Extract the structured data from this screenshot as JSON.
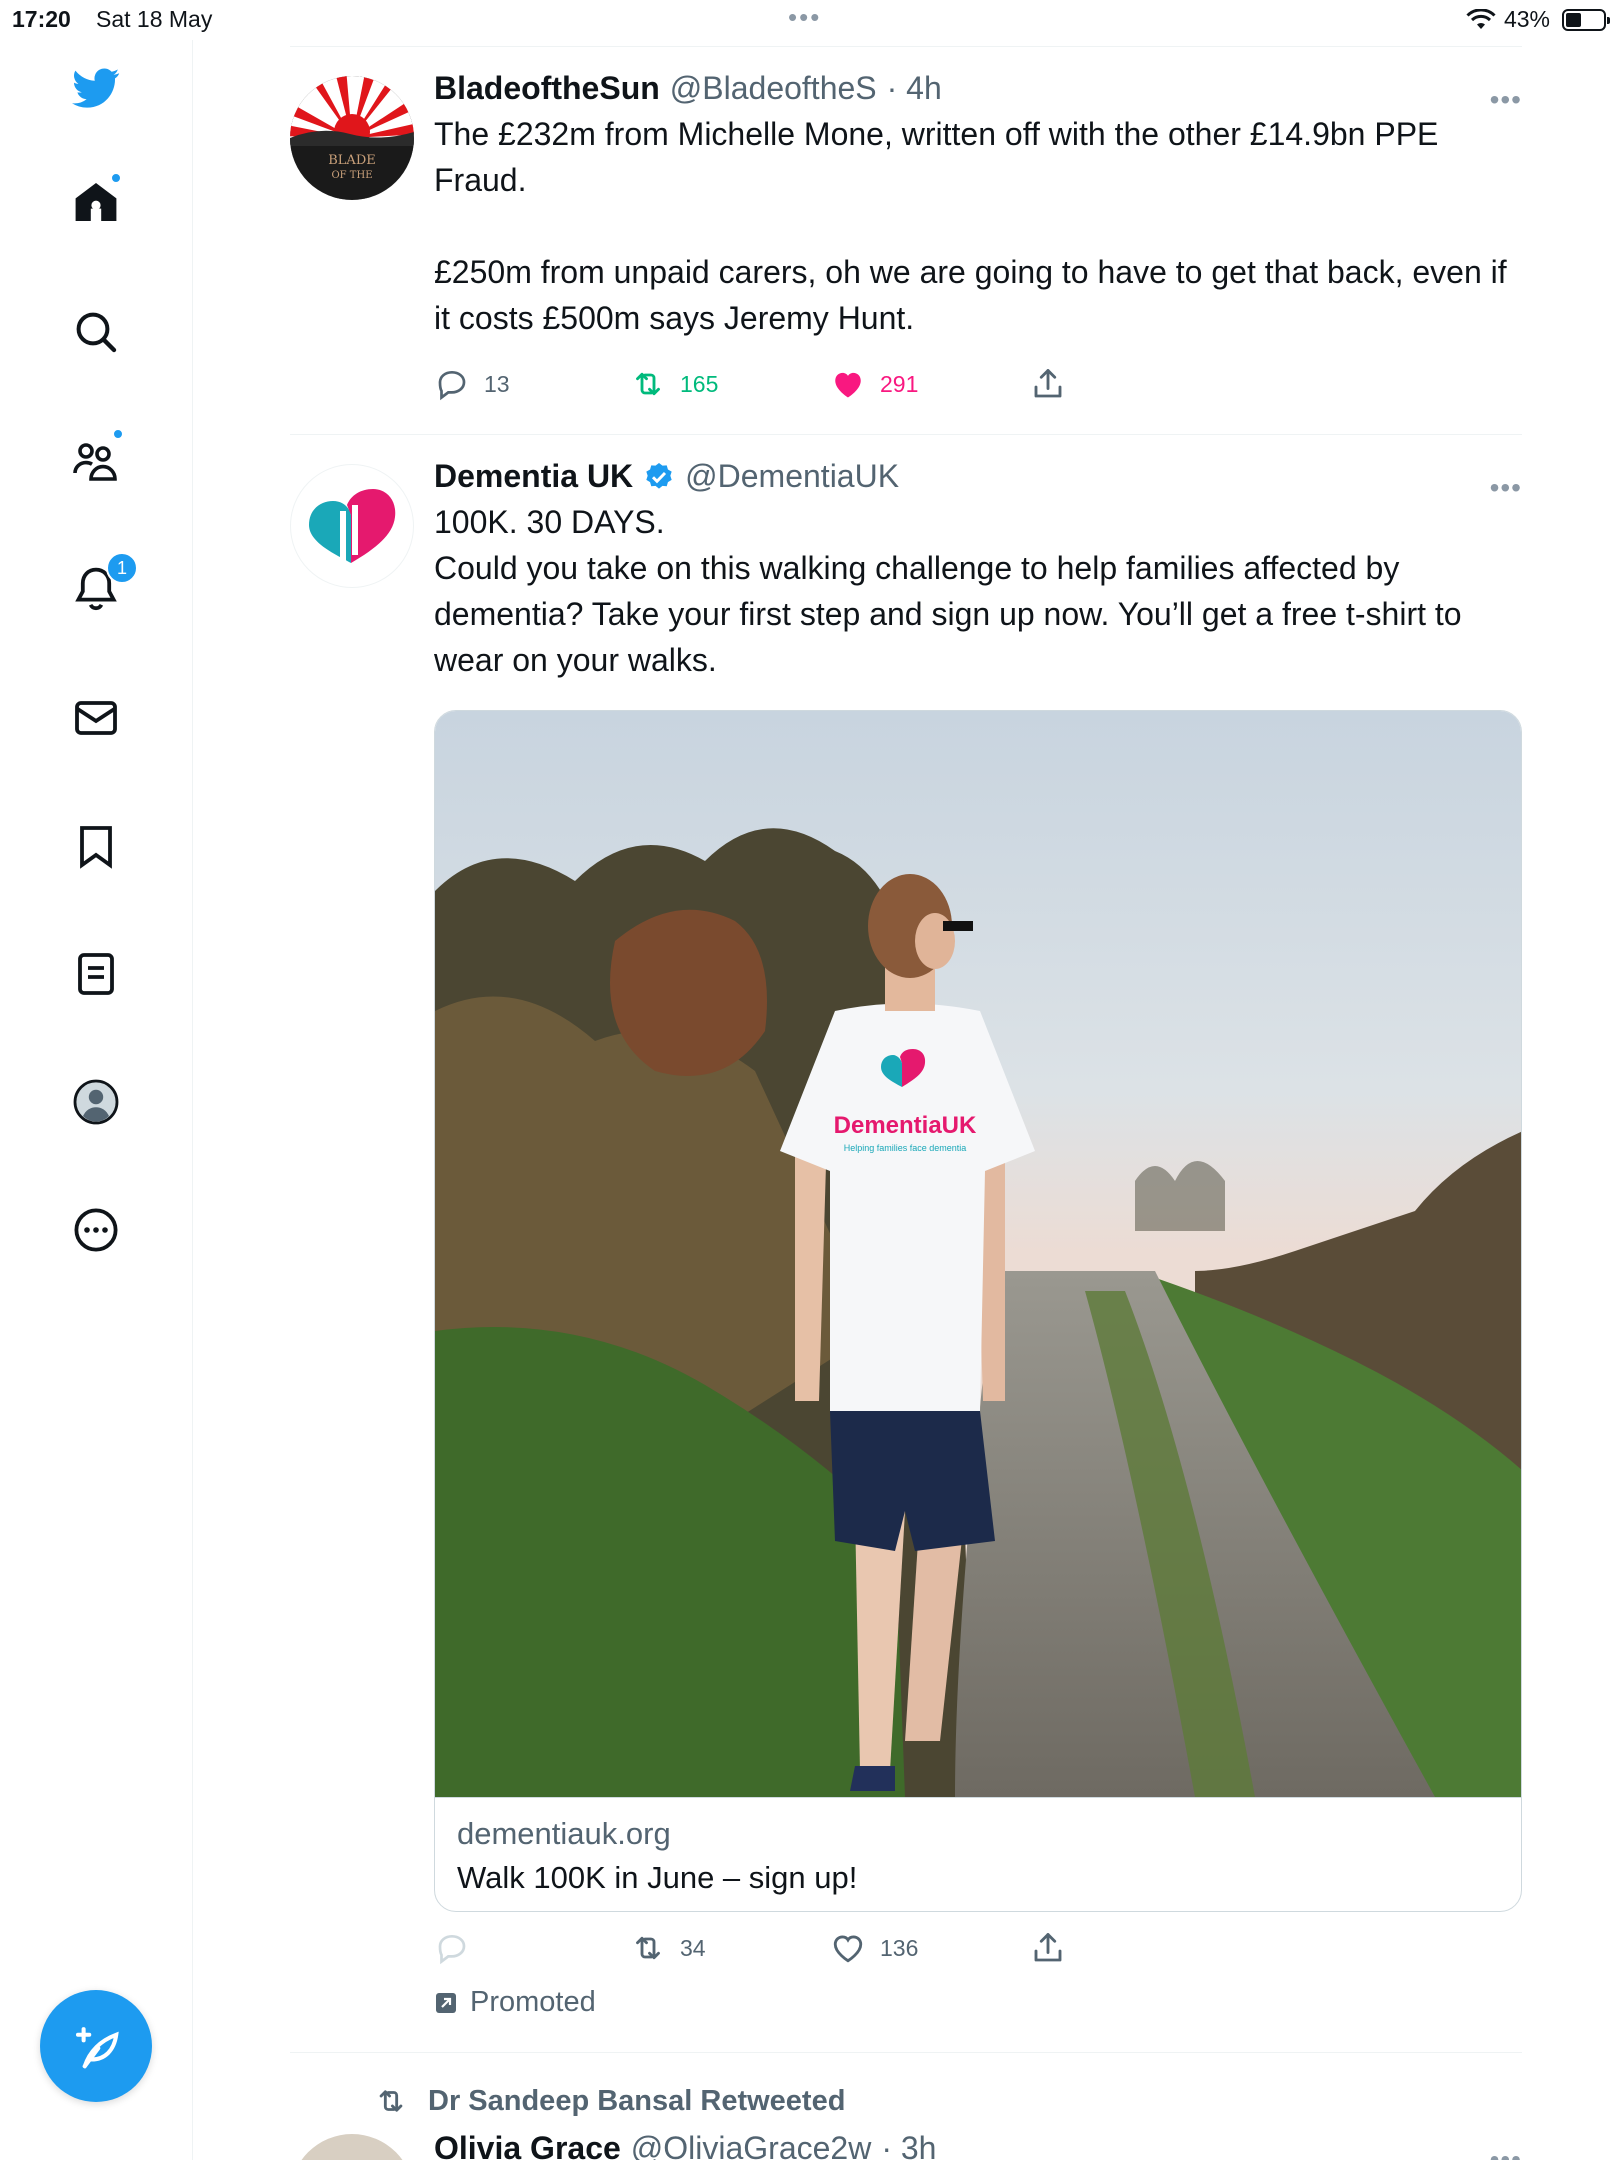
{
  "status_bar": {
    "time": "17:20",
    "date": "Sat 18 May",
    "battery": "43%",
    "battery_level": 0.43
  },
  "sidebar": {
    "items": [
      {
        "name": "home",
        "icon": "home-icon",
        "badge": "dot"
      },
      {
        "name": "explore",
        "icon": "search-icon"
      },
      {
        "name": "communities",
        "icon": "communities-icon",
        "badge": "dot"
      },
      {
        "name": "notifications",
        "icon": "bell-icon",
        "badge": "1"
      },
      {
        "name": "messages",
        "icon": "mail-icon"
      },
      {
        "name": "bookmarks",
        "icon": "bookmark-icon"
      },
      {
        "name": "lists",
        "icon": "lists-icon"
      },
      {
        "name": "profile",
        "icon": "profile-avatar-icon"
      },
      {
        "name": "more",
        "icon": "more-circle-icon"
      }
    ],
    "compose_icon": "compose-feather-icon"
  },
  "colors": {
    "accent": "#1d9bf0",
    "retweet_green": "#00ba7c",
    "like_pink": "#f91880",
    "muted": "#536471"
  },
  "tweets": [
    {
      "name": "BladeoftheSun",
      "handle": "@BladeoftheS",
      "time": "· 4h",
      "paragraphs": [
        "The £232m from Michelle Mone, written off with the other £14.9bn PPE Fraud.",
        "£250m from unpaid carers, oh we are going to have to get that back, even if it costs £500m says Jeremy Hunt."
      ],
      "avatar_text": "BLADE OF THE",
      "replies": "13",
      "retweets": "165",
      "likes": "291"
    },
    {
      "name": "Dementia UK",
      "handle": "@DementiaUK",
      "verified": true,
      "text": "100K. 30 DAYS.\nCould you take on this walking challenge to help families affected by dementia? Take your first step and sign up now. You’ll get a free t-shirt to wear on your walks.",
      "card": {
        "domain": "dementiauk.org",
        "title": "Walk 100K in June – sign up!",
        "shirt_logo": "DementiaUK",
        "shirt_tagline": "Helping families face dementia"
      },
      "replies": "",
      "retweets": "34",
      "likes": "136",
      "promoted_label": "Promoted"
    },
    {
      "retweeted_by": "Dr Sandeep Bansal Retweeted",
      "name": "Olivia Grace",
      "handle": "@OliviaGrace2w",
      "time": "· 3h"
    }
  ]
}
